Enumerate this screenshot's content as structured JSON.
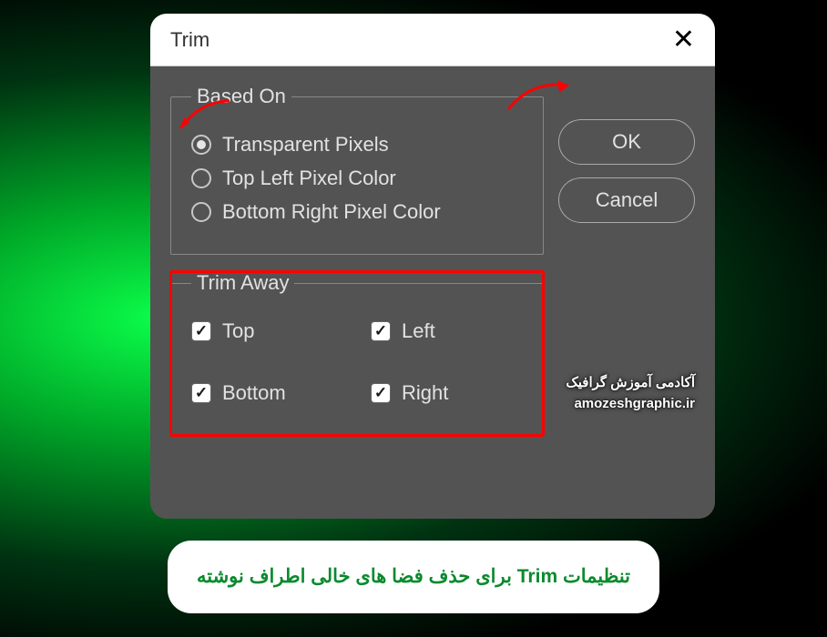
{
  "dialog": {
    "title": "Trim",
    "ok_label": "OK",
    "cancel_label": "Cancel",
    "basedOn": {
      "legend": "Based On",
      "options": {
        "transparent": "Transparent Pixels",
        "topLeft": "Top Left Pixel Color",
        "bottomRight": "Bottom Right Pixel Color"
      }
    },
    "trimAway": {
      "legend": "Trim Away",
      "top": "Top",
      "bottom": "Bottom",
      "left": "Left",
      "right": "Right"
    }
  },
  "watermark": {
    "line1": "آکادمی آموزش گرافیک",
    "line2": "amozeshgraphic.ir"
  },
  "caption": "تنظیمات Trim برای حذف فضا های خالی اطراف نوشته",
  "colors": {
    "accentRed": "#ff0000",
    "captionGreen": "#0b8a2e"
  }
}
